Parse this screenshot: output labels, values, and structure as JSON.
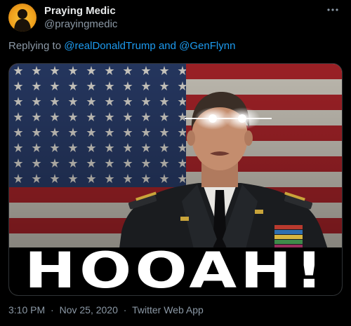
{
  "author": {
    "display_name": "Praying Medic",
    "handle": "@prayingmedic"
  },
  "reply": {
    "prefix": "Replying to",
    "user1": "@realDonaldTrump",
    "conjunction": "and",
    "user2": "@GenFlynn"
  },
  "media": {
    "caption_text": "HOOAH!"
  },
  "meta": {
    "time": "3:10 PM",
    "separator": "·",
    "date": "Nov 25, 2020",
    "source": "Twitter Web App"
  },
  "icons": {
    "more": "more-horizontal-icon",
    "avatar": "avatar-silhouette"
  },
  "colors": {
    "background": "#000000",
    "link": "#1d9bf0",
    "secondary_text": "#8b98a5",
    "primary_text": "#e7e9ea",
    "flag_red": "#b5262c",
    "flag_blue": "#2b3f6e",
    "avatar_gold": "#f0a21d"
  }
}
